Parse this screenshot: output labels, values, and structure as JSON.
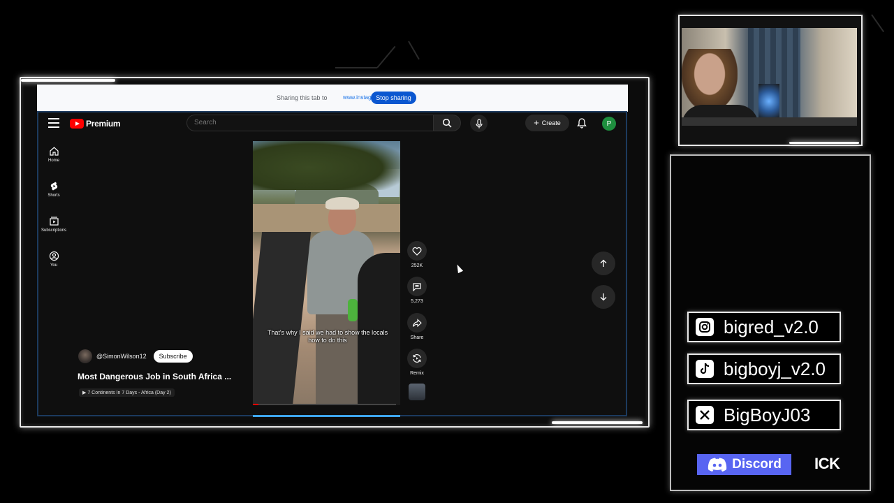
{
  "share_bar": {
    "text": "Sharing this tab to",
    "url": "www.instagram.com",
    "stop_label": "Stop sharing"
  },
  "header": {
    "logo_text": "Premium",
    "search_placeholder": "Search",
    "create_label": "Create",
    "avatar_letter": "P"
  },
  "sidebar": {
    "items": [
      {
        "label": "Home",
        "icon": "home-icon"
      },
      {
        "label": "Shorts",
        "icon": "shorts-icon"
      },
      {
        "label": "Subscriptions",
        "icon": "subscriptions-icon"
      },
      {
        "label": "You",
        "icon": "you-icon"
      }
    ]
  },
  "short": {
    "caption": "That's why I said we had to show the locals how to do this",
    "channel": "@SimonWilson12",
    "subscribe_label": "Subscribe",
    "title": "Most Dangerous Job in South Africa ...",
    "playlist": "7 Continents In 7 Days - Africa (Day 2)",
    "progress": 0.04
  },
  "actions": {
    "likes": "252K",
    "comments": "5,273",
    "share_label": "Share",
    "remix_label": "Remix"
  },
  "overlay": {
    "instagram": "bigred_v2.0",
    "tiktok": "bigboyj_v2.0",
    "x": "BigBoyJ03",
    "discord": "Discord",
    "ick": "ICK"
  },
  "colors": {
    "yt_red": "#ff0000",
    "share_blue": "#0b57d0",
    "discord": "#5865f2",
    "avatar_green": "#1e8e3e"
  }
}
